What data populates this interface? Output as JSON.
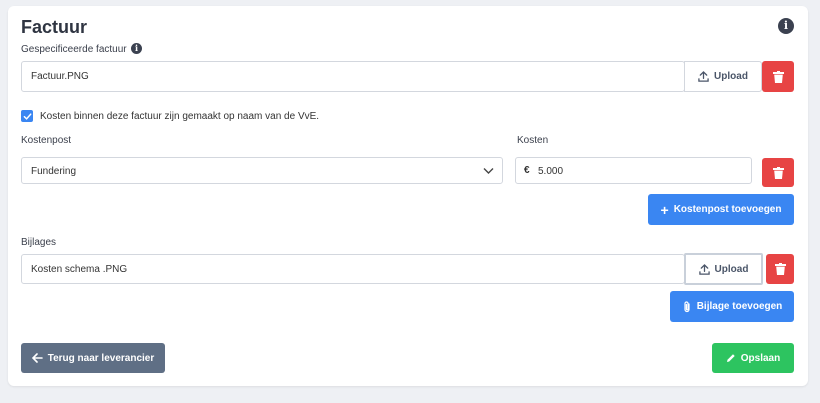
{
  "section": {
    "title": "Factuur"
  },
  "invoice": {
    "label": "Gespecificeerde factuur",
    "file_name": "Factuur.PNG",
    "upload_label": "Upload"
  },
  "vve_checkbox": {
    "checked": true,
    "label": "Kosten binnen deze factuur zijn gemaakt op naam van de VvE."
  },
  "cost_items": {
    "kostenpost_label": "Kostenpost",
    "kosten_label": "Kosten",
    "rows": [
      {
        "kostenpost": "Fundering",
        "currency": "€",
        "amount": "5.000"
      }
    ],
    "add_button_label": "Kostenpost toevoegen"
  },
  "attachments": {
    "label": "Bijlages",
    "items": [
      {
        "file_name": "Kosten schema .PNG",
        "upload_label": "Upload"
      }
    ],
    "add_button_label": "Bijlage toevoegen"
  },
  "footer": {
    "back_label": "Terug naar leverancier",
    "save_label": "Opslaan"
  },
  "colors": {
    "primary": "#3a86f2",
    "danger": "#e74444",
    "success": "#2dc460",
    "secondary": "#5f6f85"
  }
}
